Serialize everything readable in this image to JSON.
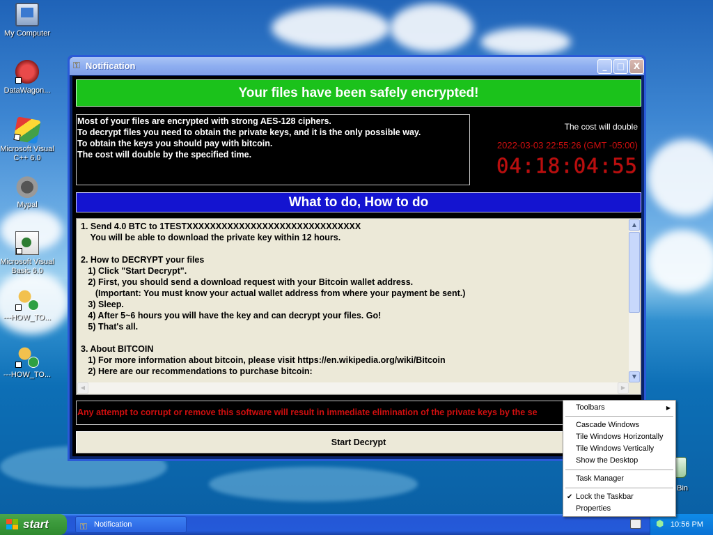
{
  "desktop": {
    "icons": [
      {
        "label": "My Computer"
      },
      {
        "label": "DataWagon..."
      },
      {
        "label": "Microsoft Visual C++ 6.0"
      },
      {
        "label": "Mypal"
      },
      {
        "label": "Microsoft Visual Basic 6.0"
      },
      {
        "label": "---HOW_TO..."
      },
      {
        "label": "---HOW_TO..."
      }
    ],
    "recycle_bin_label": "cle Bin"
  },
  "window": {
    "title": "Notification",
    "controls": {
      "minimize": "_",
      "maximize": "□",
      "close": "X"
    },
    "headline": "Your files have been safely encrypted!",
    "info_lines": [
      "Most of your files are encrypted with strong AES-128 ciphers.",
      "To decrypt files you need to obtain the private keys, and it is the only possible way.",
      "To obtain the keys you should pay with bitcoin.",
      "The cost will double by the specified time."
    ],
    "cost_label": "The cost will double",
    "deadline": "2022-03-03 22:55:26 (GMT -05:00)",
    "countdown": "04:18:04:55",
    "section_title": "What to do, How to do",
    "instructions": "1. Send 4.0 BTC to 1TESTXXXXXXXXXXXXXXXXXXXXXXXXXXXXXX\n    You will be able to download the private key within 12 hours.\n\n2. How to DECRYPT your files\n   1) Click \"Start Decrypt\".\n   2) First, you should send a download request with your Bitcoin wallet address.\n      (Important: You must know your actual wallet address from where your payment be sent.)\n   3) Sleep.\n   4) After 5~6 hours you will have the key and can decrypt your files. Go!\n   5) That's all.\n\n3. About BITCOIN\n   1) For more information about bitcoin, please visit https://en.wikipedia.org/wiki/Bitcoin\n   2) Here are our recommendations to purchase bitcoin:",
    "warning": "Any attempt to corrupt or remove this software will result in immediate elimination of the private keys by the se",
    "decrypt_button": "Start Decrypt"
  },
  "colors": {
    "headline_bg": "#1bc21b",
    "section_bg": "#1414d0",
    "alert_red": "#d10f0f"
  },
  "taskbar": {
    "start_label": "start",
    "task_label": "Notification",
    "clock": "10:56 PM"
  },
  "context_menu": {
    "items": [
      {
        "label": "Toolbars",
        "submenu": true
      },
      {
        "label": "Cascade Windows"
      },
      {
        "label": "Tile Windows Horizontally"
      },
      {
        "label": "Tile Windows Vertically"
      },
      {
        "label": "Show the Desktop"
      },
      {
        "label": "Task Manager"
      },
      {
        "label": "Lock the Taskbar",
        "checked": true
      },
      {
        "label": "Properties"
      }
    ]
  }
}
